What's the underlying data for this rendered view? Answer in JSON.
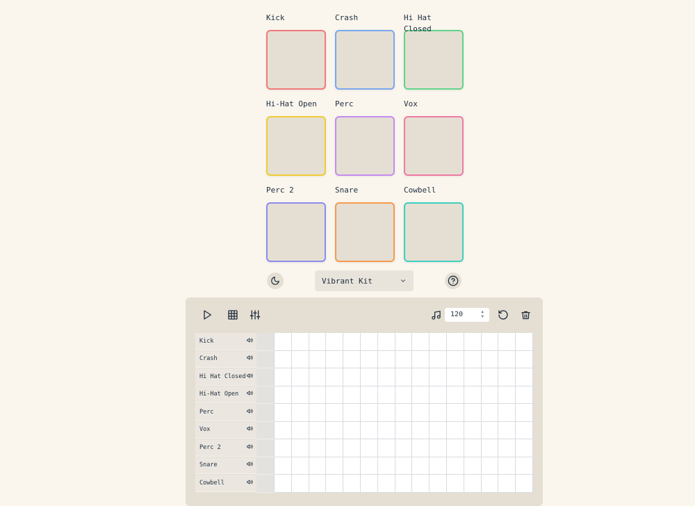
{
  "pads": [
    {
      "label": "Kick",
      "color": "#f07a7a"
    },
    {
      "label": "Crash",
      "color": "#7aa7ee"
    },
    {
      "label": "Hi Hat Closed",
      "color": "#5fd48a"
    },
    {
      "label": "Hi-Hat Open",
      "color": "#f0cc33"
    },
    {
      "label": "Perc",
      "color": "#c58cf0"
    },
    {
      "label": "Vox",
      "color": "#ee7ba4"
    },
    {
      "label": "Perc 2",
      "color": "#8c8cf0"
    },
    {
      "label": "Snare",
      "color": "#f59a4e"
    },
    {
      "label": "Cowbell",
      "color": "#3ecfbe"
    }
  ],
  "kit": {
    "selected": "Vibrant Kit"
  },
  "toolbar": {
    "bpm": "120"
  },
  "tracks": [
    "Kick",
    "Crash",
    "Hi Hat Closed",
    "Hi-Hat Open",
    "Perc",
    "Vox",
    "Perc 2",
    "Snare",
    "Cowbell"
  ],
  "steps": 16,
  "icons": {
    "theme": "moon-icon",
    "help": "help-circle-icon",
    "play": "play-icon",
    "grid": "grid-icon",
    "mixer": "sliders-icon",
    "tempo": "music-note-icon",
    "reset": "reset-icon",
    "clear": "trash-icon",
    "volume": "volume-icon",
    "dropdown": "chevron-down-icon"
  }
}
